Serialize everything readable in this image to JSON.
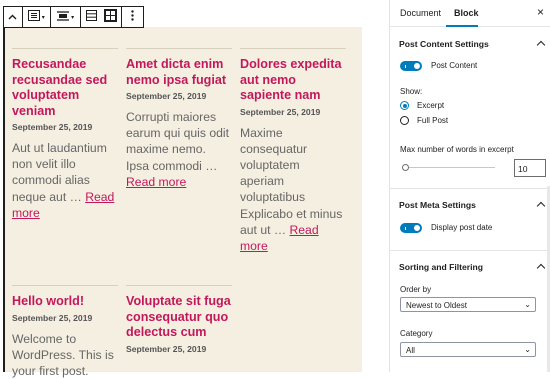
{
  "toolbar": {
    "icons": [
      "chevron-up-icon",
      "list-view-icon",
      "align-icon",
      "list-icon",
      "grid-icon",
      "more-options-icon"
    ]
  },
  "posts": [
    {
      "title": "Recusandae recusandae sed voluptatem veniam",
      "date": "September 25, 2019",
      "excerpt": "Aut ut laudantium non velit illo commodi alias neque aut …",
      "read_more": "Read more"
    },
    {
      "title": "Amet dicta enim nemo ipsa fugiat",
      "date": "September 25, 2019",
      "excerpt": "Corrupti maiores earum qui quis odit maxime nemo. Ipsa commodi …",
      "read_more": "Read more"
    },
    {
      "title": "Dolores expedita aut nemo sapiente nam",
      "date": "September 25, 2019",
      "excerpt": "Maxime consequatur voluptatem aperiam voluptatibus Explicabo et minus aut ut …",
      "read_more": "Read more"
    },
    {
      "title": "Hello world!",
      "date": "September 25, 2019",
      "excerpt": "Welcome to WordPress. This is your first post.",
      "read_more": ""
    },
    {
      "title": "Voluptate sit fuga consequatur quo delectus cum",
      "date": "September 25, 2019",
      "excerpt": "",
      "read_more": ""
    }
  ],
  "sidebar": {
    "tabs": [
      "Document",
      "Block"
    ],
    "active_tab": "Block",
    "post_content_settings": {
      "title": "Post Content Settings",
      "toggle_label": "Post Content",
      "show_label": "Show:",
      "options": [
        "Excerpt",
        "Full Post"
      ],
      "selected": "Excerpt",
      "max_words_label": "Max number of words in excerpt",
      "max_words_value": "10"
    },
    "post_meta_settings": {
      "title": "Post Meta Settings",
      "toggle_label": "Display post date"
    },
    "sorting": {
      "title": "Sorting and Filtering",
      "order_label": "Order by",
      "order_value": "Newest to Oldest",
      "category_label": "Category",
      "category_value": "All"
    }
  },
  "colors": {
    "accent": "#007cba",
    "title": "#c2185b",
    "canvas_bg": "#f4efe1"
  }
}
